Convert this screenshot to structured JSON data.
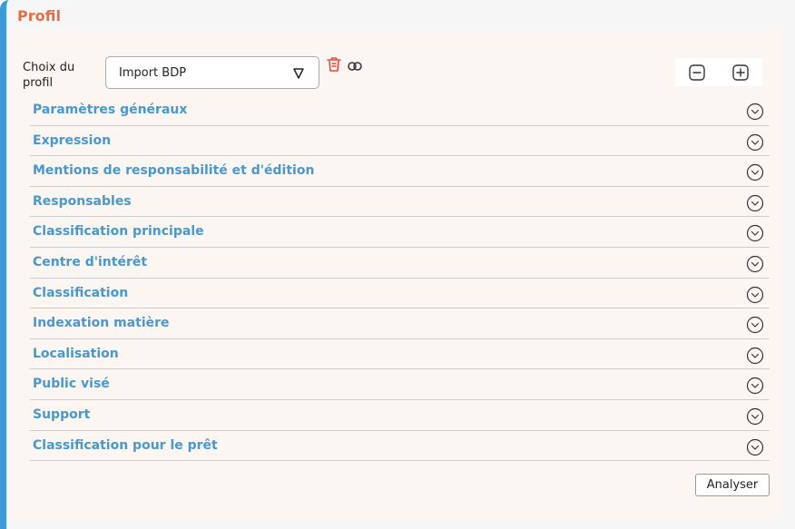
{
  "card": {
    "title": "Profil"
  },
  "profile": {
    "label": "Choix du profil",
    "selected": "Import BDP"
  },
  "icons": {
    "dropdown": "shield-chevron-icon",
    "delete": "trash-icon",
    "link": "link-icon",
    "zoom_out": "minus-square-icon",
    "zoom_in": "plus-square-icon",
    "expand": "chevron-down-circle-icon"
  },
  "sections": [
    {
      "label": "Paramètres généraux"
    },
    {
      "label": "Expression"
    },
    {
      "label": "Mentions de responsabilité et d'édition"
    },
    {
      "label": "Responsables"
    },
    {
      "label": "Classification principale"
    },
    {
      "label": "Centre d'intérêt"
    },
    {
      "label": "Classification"
    },
    {
      "label": "Indexation matière"
    },
    {
      "label": "Localisation"
    },
    {
      "label": "Public visé"
    },
    {
      "label": "Support"
    },
    {
      "label": "Classification pour le prêt"
    }
  ],
  "actions": {
    "analyse_label": "Analyser"
  },
  "colors": {
    "accent_blue": "#3c9bd6",
    "title_orange": "#e0704a",
    "section_blue": "#4898cc",
    "delete_red": "#e04a3c"
  }
}
